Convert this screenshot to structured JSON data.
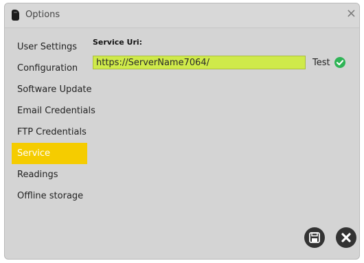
{
  "window": {
    "title": "Options",
    "close_glyph": "×",
    "app_icon": "phone-icon"
  },
  "sidebar": {
    "items": [
      {
        "label": "User Settings"
      },
      {
        "label": "Configuration"
      },
      {
        "label": "Software Update"
      },
      {
        "label": "Email Credentials"
      },
      {
        "label": "FTP Credentials"
      },
      {
        "label": "Service",
        "active": true
      },
      {
        "label": "Readings"
      },
      {
        "label": "Offline storage"
      }
    ],
    "active_color": "#f5cc00"
  },
  "service": {
    "uri_label": "Service Uri:",
    "uri_value": "https://ServerName7064/",
    "test_label": "Test",
    "test_status_icon": "check-circle-icon",
    "input_highlight_color": "#cfea4a",
    "status_color": "#2fb456"
  },
  "footer": {
    "save_icon": "floppy-disk-icon",
    "cancel_icon": "close-icon"
  }
}
